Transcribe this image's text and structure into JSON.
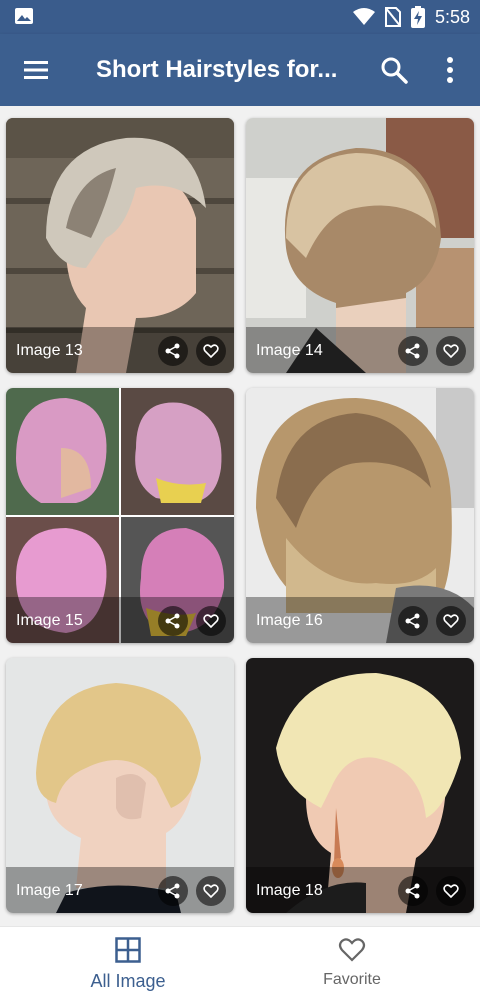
{
  "status_bar": {
    "time": "5:58"
  },
  "app_bar": {
    "title": "Short Hairstyles for..."
  },
  "images": [
    {
      "caption": "Image 13"
    },
    {
      "caption": "Image 14"
    },
    {
      "caption": "Image 15"
    },
    {
      "caption": "Image 16"
    },
    {
      "caption": "Image 17"
    },
    {
      "caption": "Image 18"
    }
  ],
  "bottom_nav": {
    "all_image_label": "All Image",
    "favorite_label": "Favorite"
  },
  "colors": {
    "primary": "#3c5f8f",
    "status_bar": "#3a5c8c",
    "nav_inactive": "#666666"
  }
}
